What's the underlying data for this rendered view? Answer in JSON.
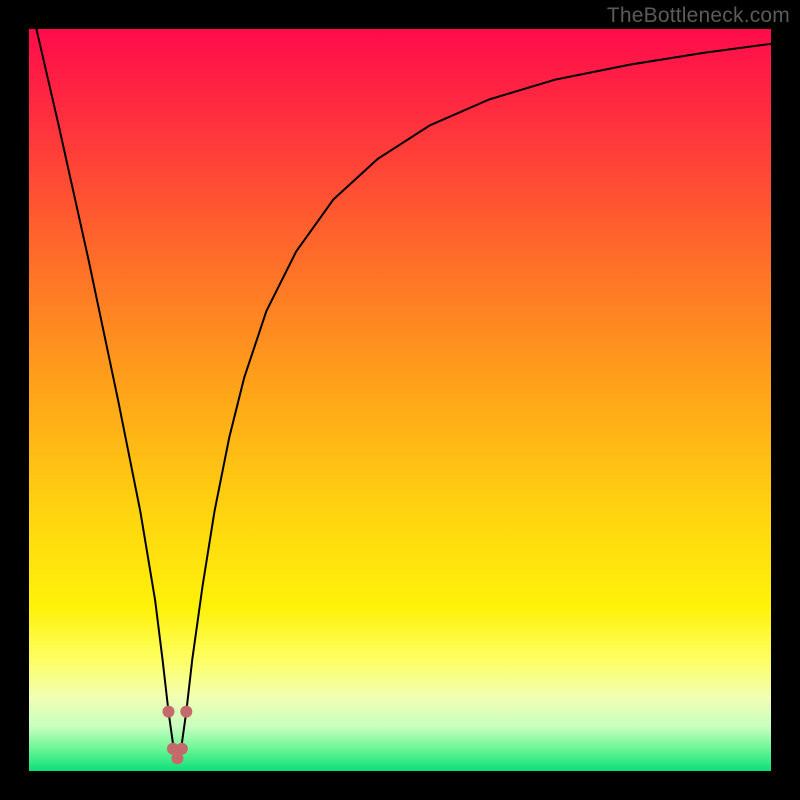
{
  "watermark": "TheBottleneck.com",
  "chart_data": {
    "type": "line",
    "title": "",
    "xlabel": "",
    "ylabel": "",
    "xlim": [
      0,
      100
    ],
    "ylim": [
      0,
      100
    ],
    "grid": false,
    "legend": false,
    "background_gradient": {
      "stops": [
        {
          "offset": 0.0,
          "color": "#ff0b4b"
        },
        {
          "offset": 0.12,
          "color": "#ff2f3e"
        },
        {
          "offset": 0.3,
          "color": "#ff6a2a"
        },
        {
          "offset": 0.48,
          "color": "#ffa21a"
        },
        {
          "offset": 0.66,
          "color": "#ffd60f"
        },
        {
          "offset": 0.78,
          "color": "#fff20a"
        },
        {
          "offset": 0.85,
          "color": "#fdff63"
        },
        {
          "offset": 0.9,
          "color": "#f2ffb2"
        },
        {
          "offset": 0.94,
          "color": "#c8ffbf"
        },
        {
          "offset": 0.97,
          "color": "#6cf596"
        },
        {
          "offset": 1.0,
          "color": "#0be07a"
        }
      ]
    },
    "series": [
      {
        "name": "curve",
        "stroke": "#000000",
        "stroke_width": 2,
        "x": [
          1,
          4,
          8,
          12,
          15,
          17,
          18,
          18.8,
          19.5,
          20,
          20.5,
          21.2,
          22,
          23.4,
          25,
          27,
          29,
          32,
          36,
          41,
          47,
          54,
          62,
          71,
          81,
          91,
          100
        ],
        "y": [
          100,
          87,
          69,
          50,
          35,
          23,
          15,
          8,
          3,
          1.5,
          3,
          8,
          15,
          25,
          35,
          45,
          53,
          62,
          70,
          77,
          82.5,
          87,
          90.5,
          93.2,
          95.2,
          96.8,
          98
        ]
      }
    ],
    "markers": [
      {
        "name": "dot-1",
        "x": 18.8,
        "y": 8.0,
        "r": 6,
        "color": "#c46a6a"
      },
      {
        "name": "dot-2",
        "x": 19.4,
        "y": 3.0,
        "r": 6,
        "color": "#c46a6a"
      },
      {
        "name": "dot-3",
        "x": 20.0,
        "y": 1.7,
        "r": 6,
        "color": "#c46a6a"
      },
      {
        "name": "dot-4",
        "x": 20.6,
        "y": 3.0,
        "r": 6,
        "color": "#c46a6a"
      },
      {
        "name": "dot-5",
        "x": 21.2,
        "y": 8.0,
        "r": 6,
        "color": "#c46a6a"
      }
    ]
  }
}
